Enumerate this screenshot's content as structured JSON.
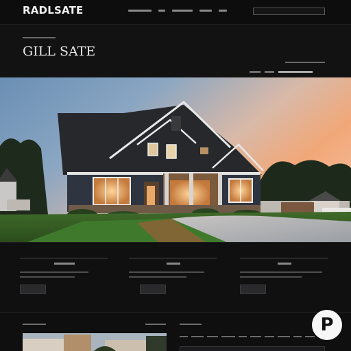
{
  "header": {
    "logo": "RADLSATE",
    "title": "GILL SATE",
    "search_placeholder": ""
  },
  "badge": {
    "letter": "P"
  },
  "colors": {
    "background": "#111112",
    "topbar": "#0d0d0e",
    "badge": "#f7f7f7"
  },
  "icons": {
    "badge": "p-badge-icon"
  }
}
